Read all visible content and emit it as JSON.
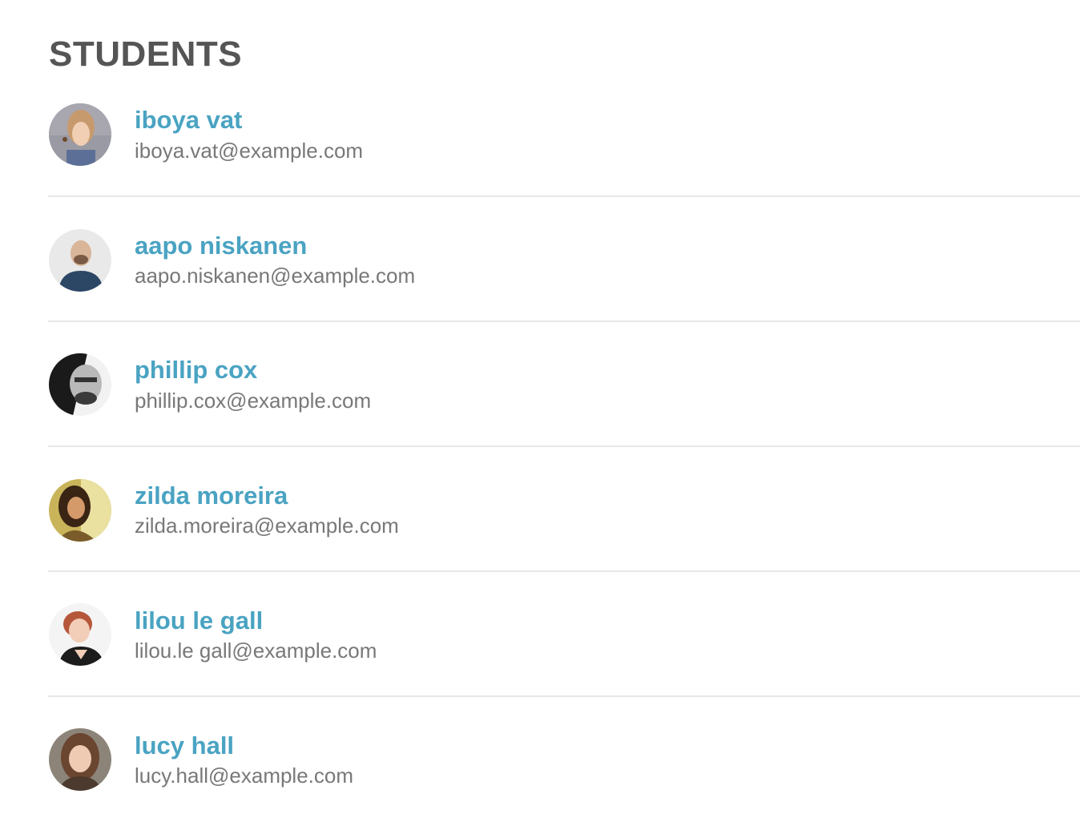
{
  "page": {
    "title": "STUDENTS"
  },
  "students": [
    {
      "name": "iboya vat",
      "email": "iboya.vat@example.com",
      "avatar_icon": "avatar-photo-icon"
    },
    {
      "name": "aapo niskanen",
      "email": "aapo.niskanen@example.com",
      "avatar_icon": "avatar-photo-icon"
    },
    {
      "name": "phillip cox",
      "email": "phillip.cox@example.com",
      "avatar_icon": "avatar-photo-icon"
    },
    {
      "name": "zilda moreira",
      "email": "zilda.moreira@example.com",
      "avatar_icon": "avatar-photo-icon"
    },
    {
      "name": "lilou le gall",
      "email": "lilou.le gall@example.com",
      "avatar_icon": "avatar-photo-icon"
    },
    {
      "name": "lucy hall",
      "email": "lucy.hall@example.com",
      "avatar_icon": "avatar-photo-icon"
    }
  ],
  "colors": {
    "title": "#555555",
    "name_link": "#4aa3c2",
    "email_text": "#787878",
    "divider": "#e8e8e8"
  }
}
